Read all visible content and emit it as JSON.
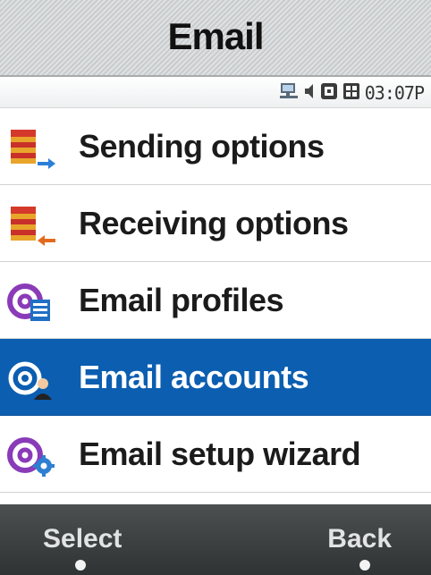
{
  "window": {
    "title": "Email"
  },
  "status_bar": {
    "time": "03:07P",
    "icons": [
      "network-icon",
      "speaker-icon",
      "roaming-icon",
      "sim-icon"
    ]
  },
  "menu": {
    "items": [
      {
        "label": "Sending options",
        "icon": "sending-options-icon",
        "selected": false
      },
      {
        "label": "Receiving options",
        "icon": "receiving-options-icon",
        "selected": false
      },
      {
        "label": "Email profiles",
        "icon": "email-profiles-icon",
        "selected": false
      },
      {
        "label": "Email accounts",
        "icon": "email-accounts-icon",
        "selected": true
      },
      {
        "label": "Email setup wizard",
        "icon": "email-setup-wizard-icon",
        "selected": false
      }
    ]
  },
  "softkeys": {
    "left": "Select",
    "right": "Back"
  },
  "colors": {
    "selection": "#0b5eb0",
    "softbar": "#3b3f3f",
    "title_text": "#111111"
  }
}
